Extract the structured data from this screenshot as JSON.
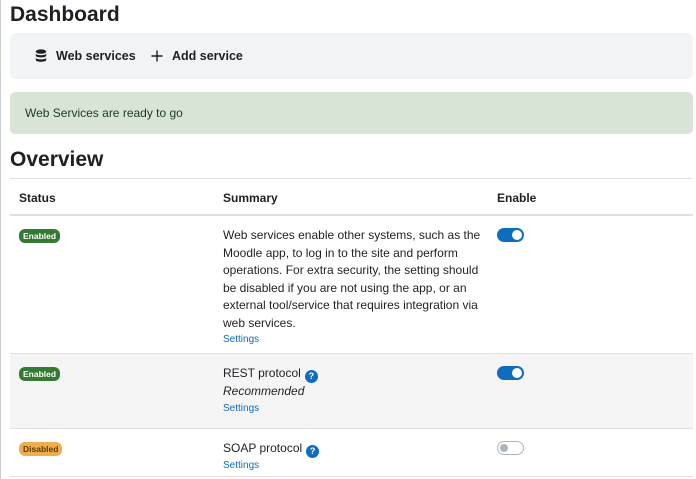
{
  "page": {
    "title": "Dashboard"
  },
  "action_bar": {
    "web_services_label": "Web services",
    "add_service_label": "Add service"
  },
  "alert": {
    "text": "Web Services are ready to go"
  },
  "overview": {
    "title": "Overview",
    "headers": {
      "status": "Status",
      "summary": "Summary",
      "enable": "Enable"
    },
    "rows": [
      {
        "status": "Enabled",
        "summary": "Web services enable other systems, such as the Moodle app, to log in to the site and perform operations. For extra security, the setting should be disabled if you are not using the app, or an external tool/service that requires integration via web services.",
        "settings": "Settings",
        "enabled": true
      },
      {
        "status": "Enabled",
        "summary": "REST protocol",
        "note": "Recommended",
        "settings": "Settings",
        "enabled": true
      },
      {
        "status": "Disabled",
        "summary": "SOAP protocol",
        "settings": "Settings",
        "enabled": false
      }
    ]
  },
  "help_icon_glyph": "?",
  "colors": {
    "primary": "#0f6cbf",
    "success_badge": "#357a32",
    "warning_badge": "#f0ad4e",
    "alert_bg": "#d8e5d6",
    "action_bar_bg": "#f1f3f5"
  },
  "icons": {
    "web_services": "database-icon",
    "add_service": "plus-icon",
    "help": "question-circle-icon"
  }
}
